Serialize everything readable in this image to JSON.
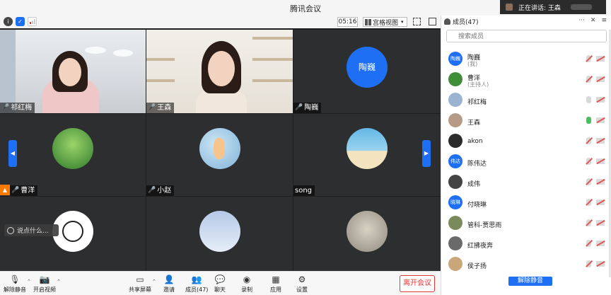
{
  "window": {
    "title": "腾讯会议"
  },
  "speaking": {
    "label": "正在讲话: 王森"
  },
  "toolbar": {
    "timer": "05:16",
    "view_label": "宫格视图"
  },
  "tiles": [
    {
      "name": "祁红梅"
    },
    {
      "name": "王森"
    },
    {
      "name": "陶巍",
      "avatar_text": "陶巍"
    },
    {
      "name": ""
    },
    {
      "name": "小赵"
    },
    {
      "name": ""
    },
    {
      "name": "曹洋"
    },
    {
      "name": ""
    },
    {
      "name": "song"
    }
  ],
  "chat_hint": "说点什么...",
  "bottombar": {
    "unmute": "解除静音",
    "start_video": "开启视频",
    "share": "共享屏幕",
    "invite": "邀请",
    "members": "成员(47)",
    "chat": "聊天",
    "record": "录制",
    "apps": "应用",
    "settings": "设置",
    "leave": "离开会议"
  },
  "panel": {
    "title": "成员(47)",
    "search_placeholder": "搜索成员",
    "members": [
      {
        "name": "陶巍",
        "role": "(我)",
        "avatar_text": "陶巍",
        "avatar_color": "#1e6ff3",
        "mic": "muted"
      },
      {
        "name": "曹洋",
        "role": "(主持人)",
        "avatar_text": "",
        "avatar_color": "#3f8f3a",
        "mic": "muted"
      },
      {
        "name": "祁红梅",
        "role": "",
        "avatar_text": "",
        "avatar_color": "#9ab3d1",
        "mic": "off"
      },
      {
        "name": "王森",
        "role": "",
        "avatar_text": "",
        "avatar_color": "#b59a86",
        "mic": "on"
      },
      {
        "name": "akon",
        "role": "",
        "avatar_text": "",
        "avatar_color": "#2b2b2b",
        "mic": "muted"
      },
      {
        "name": "陈伟达",
        "role": "",
        "avatar_text": "伟达",
        "avatar_color": "#1e6ff3",
        "mic": "muted"
      },
      {
        "name": "成伟",
        "role": "",
        "avatar_text": "",
        "avatar_color": "#444444",
        "mic": "muted"
      },
      {
        "name": "付晓琳",
        "role": "",
        "avatar_text": "晓琳",
        "avatar_color": "#1e6ff3",
        "mic": "muted"
      },
      {
        "name": "管科-贾思雨",
        "role": "",
        "avatar_text": "",
        "avatar_color": "#7a8a5a",
        "mic": "muted"
      },
      {
        "name": "红拂夜奔",
        "role": "",
        "avatar_text": "",
        "avatar_color": "#6a6a6a",
        "mic": "muted"
      },
      {
        "name": "侯子扬",
        "role": "",
        "avatar_text": "",
        "avatar_color": "#c9a77a",
        "mic": "muted"
      }
    ],
    "unmute_all": "解除静音"
  },
  "colors": {
    "accent": "#1e6ff3",
    "active_speaker": "#47c05c",
    "leave": "#e53935",
    "host_badge": "#ff7a00"
  }
}
